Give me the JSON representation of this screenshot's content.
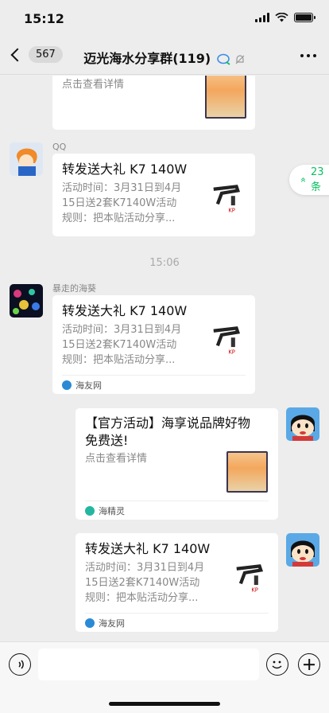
{
  "status_bar": {
    "time": "15:12"
  },
  "nav": {
    "unread_count": "567",
    "title": "迈光海水分享群(119)"
  },
  "new_messages": {
    "count_label": "23条"
  },
  "timestamp": "15:06",
  "messages": [
    {
      "desc": "点击查看详情"
    },
    {
      "sender": "QQ",
      "title": "转发送大礼 K7 140W",
      "desc_line1": "活动时间：3月31日到4月",
      "desc_line2": "15日送2套K7140W活动",
      "desc_line3": "规则：把本贴活动分享..."
    },
    {
      "sender": "暴走的海葵",
      "title": "转发送大礼 K7 140W",
      "desc_line1": "活动时间：3月31日到4月",
      "desc_line2": "15日送2套K7140W活动",
      "desc_line3": "规则：把本贴活动分享...",
      "source": "海友网"
    },
    {
      "title_line1": "【官方活动】海享说品牌好物",
      "title_line2": "免费送!",
      "desc": "点击查看详情",
      "source": "海精灵"
    },
    {
      "title": "转发送大礼 K7 140W",
      "desc_line1": "活动时间：3月31日到4月",
      "desc_line2": "15日送2套K7140W活动",
      "desc_line3": "规则：把本贴活动分享...",
      "source": "海友网"
    }
  ],
  "colors": {
    "accent": "#07c160",
    "background": "#ededed"
  }
}
